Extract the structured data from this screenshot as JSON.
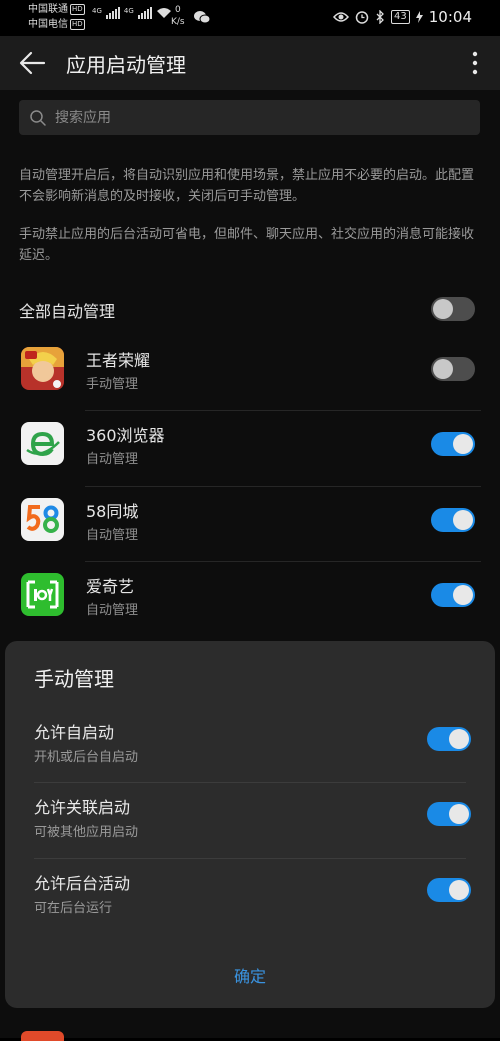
{
  "status_bar": {
    "carrier1": "中国联通",
    "carrier2": "中国电信",
    "hd": "HD",
    "net1": "4G",
    "net2": "4G",
    "speed_value": "0",
    "speed_unit": "K/s",
    "battery": "43",
    "time": "10:04"
  },
  "app_bar": {
    "title": "应用启动管理"
  },
  "search": {
    "placeholder": "搜索应用"
  },
  "description": {
    "para1": "自动管理开启后，将自动识别应用和使用场景，禁止应用不必要的启动。此配置不会影响新消息的及时接收，关闭后可手动管理。",
    "para2": "手动禁止应用的后台活动可省电，但邮件、聊天应用、社交应用的消息可能接收延迟。"
  },
  "all_auto": {
    "label": "全部自动管理",
    "enabled": false
  },
  "apps": [
    {
      "name": "王者荣耀",
      "mode": "手动管理",
      "enabled": false,
      "icon": "game-icon"
    },
    {
      "name": "360浏览器",
      "mode": "自动管理",
      "enabled": true,
      "icon": "browser-icon"
    },
    {
      "name": "58同城",
      "mode": "自动管理",
      "enabled": true,
      "icon": "58-icon"
    },
    {
      "name": "爱奇艺",
      "mode": "自动管理",
      "enabled": true,
      "icon": "iqiyi-icon"
    }
  ],
  "dialog": {
    "title": "手动管理",
    "options": [
      {
        "label": "允许自启动",
        "sub": "开机或后台自启动",
        "enabled": true
      },
      {
        "label": "允许关联启动",
        "sub": "可被其他应用启动",
        "enabled": true
      },
      {
        "label": "允许后台活动",
        "sub": "可在后台运行",
        "enabled": true
      }
    ],
    "confirm": "确定"
  },
  "colors": {
    "accent": "#1a8ae6",
    "confirm_text": "#3a93e0",
    "dialog_bg": "#2c2c2c",
    "background": "#0d0d0d"
  }
}
